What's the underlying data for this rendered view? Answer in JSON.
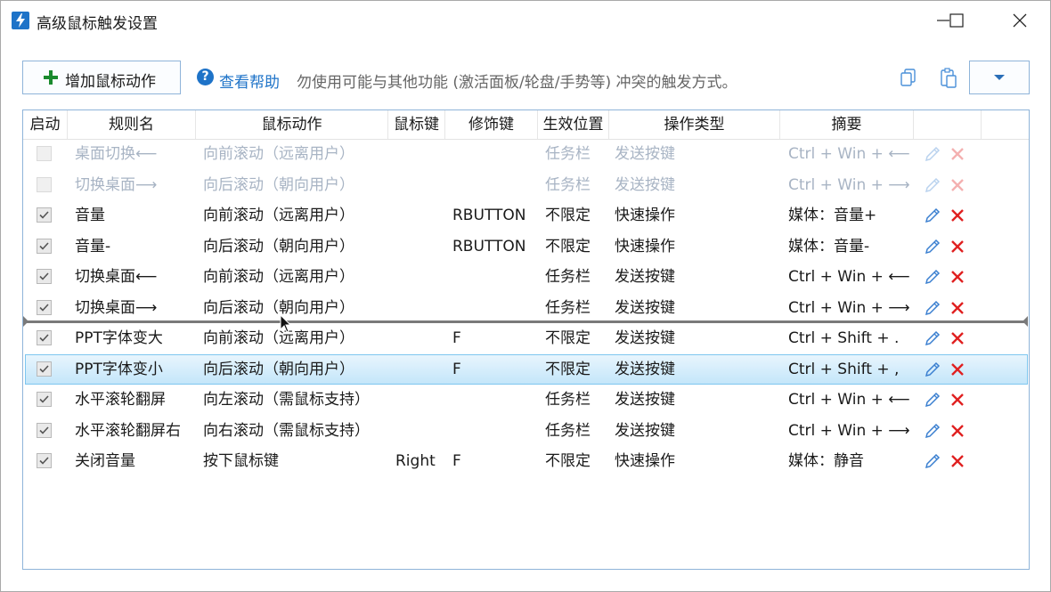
{
  "window": {
    "title": "高级鼠标触发设置"
  },
  "toolbar": {
    "add_label": "增加鼠标动作",
    "help_label": "查看帮助",
    "hint": "勿使用可能与其他功能 (激活面板/轮盘/手势等) 冲突的触发方式。"
  },
  "columns": [
    "启动",
    "规则名",
    "鼠标动作",
    "鼠标键",
    "修饰键",
    "生效位置",
    "操作类型",
    "摘要"
  ],
  "rows": [
    {
      "enabled": false,
      "name": "桌面切换⟵",
      "action": "向前滚动（远离用户）",
      "button": "",
      "modifier": "",
      "scope": "任务栏",
      "type": "发送按键",
      "summary": "Ctrl + Win + ⟵",
      "disabled": true
    },
    {
      "enabled": false,
      "name": "切换桌面⟶",
      "action": "向后滚动（朝向用户）",
      "button": "",
      "modifier": "",
      "scope": "任务栏",
      "type": "发送按键",
      "summary": "Ctrl + Win + ⟶",
      "disabled": true
    },
    {
      "enabled": true,
      "name": "音量",
      "action": "向前滚动（远离用户）",
      "button": "",
      "modifier": "RBUTTON",
      "scope": "不限定",
      "type": "快速操作",
      "summary": "媒体：音量+"
    },
    {
      "enabled": true,
      "name": "音量-",
      "action": "向后滚动（朝向用户）",
      "button": "",
      "modifier": "RBUTTON",
      "scope": "不限定",
      "type": "快速操作",
      "summary": "媒体：音量-"
    },
    {
      "enabled": true,
      "name": "切换桌面⟵",
      "action": "向前滚动（远离用户）",
      "button": "",
      "modifier": "",
      "scope": "任务栏",
      "type": "发送按键",
      "summary": "Ctrl + Win + ⟵"
    },
    {
      "enabled": true,
      "name": "切换桌面⟶",
      "action": "向后滚动（朝向用户）",
      "button": "",
      "modifier": "",
      "scope": "任务栏",
      "type": "发送按键",
      "summary": "Ctrl + Win + ⟶"
    },
    {
      "enabled": true,
      "name": "PPT字体变大",
      "action": "向前滚动（远离用户）",
      "button": "",
      "modifier": "F",
      "scope": "不限定",
      "type": "发送按键",
      "summary": "Ctrl + Shift + ."
    },
    {
      "enabled": true,
      "name": "PPT字体变小",
      "action": "向后滚动（朝向用户）",
      "button": "",
      "modifier": "F",
      "scope": "不限定",
      "type": "发送按键",
      "summary": "Ctrl + Shift + ,",
      "selected": true
    },
    {
      "enabled": true,
      "name": "水平滚轮翻屏",
      "action": "向左滚动（需鼠标支持）",
      "button": "",
      "modifier": "",
      "scope": "任务栏",
      "type": "发送按键",
      "summary": "Ctrl + Win + ⟵"
    },
    {
      "enabled": true,
      "name": "水平滚轮翻屏右",
      "action": "向右滚动（需鼠标支持）",
      "button": "",
      "modifier": "",
      "scope": "任务栏",
      "type": "发送按键",
      "summary": "Ctrl + Win + ⟶"
    },
    {
      "enabled": true,
      "name": "关闭音量",
      "action": "按下鼠标键",
      "button": "Right",
      "modifier": "F",
      "scope": "不限定",
      "type": "快速操作",
      "summary": "媒体：静音"
    }
  ]
}
